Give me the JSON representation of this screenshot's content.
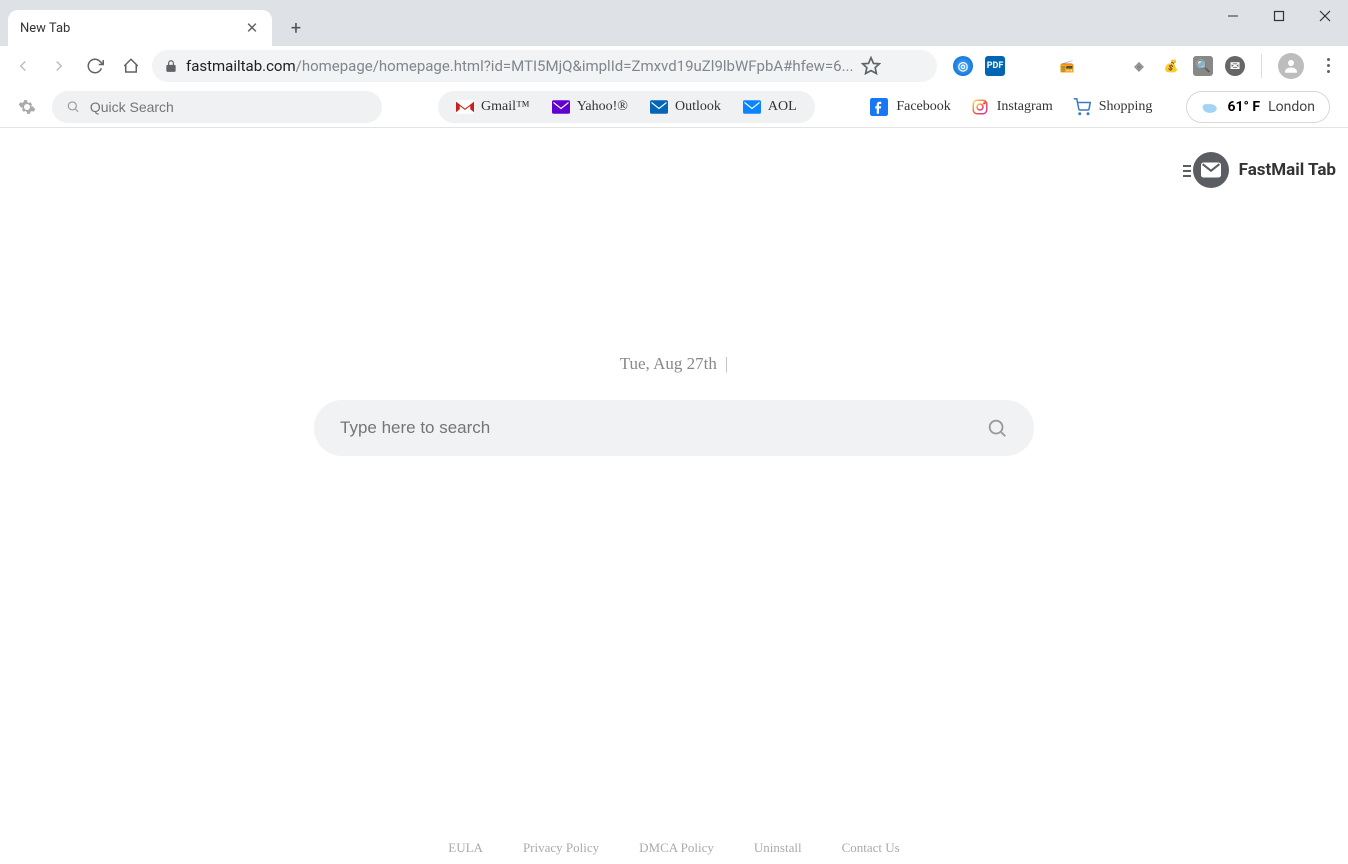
{
  "browser": {
    "tab_title": "New Tab",
    "url_host": "fastmailtab.com",
    "url_path": "/homepage/homepage.html?id=MTI5MjQ&implId=Zmxvd19uZl9lbWFpbA#hfew=6..."
  },
  "toolbar": {
    "quick_search_placeholder": "Quick Search",
    "mail_links": [
      {
        "label": "Gmail™",
        "color": "#d93025"
      },
      {
        "label": "Yahoo!®",
        "color": "#6b1fb3"
      },
      {
        "label": "Outlook",
        "color": "#0364b8"
      },
      {
        "label": "AOL",
        "color": "#0a84ff"
      }
    ],
    "social_links": [
      {
        "label": "Facebook"
      },
      {
        "label": "Instagram"
      },
      {
        "label": "Shopping"
      }
    ],
    "weather": {
      "temp": "61° F",
      "location": "London"
    }
  },
  "brand": {
    "name": "FastMail Tab"
  },
  "main": {
    "date": "Tue, Aug 27th",
    "search_placeholder": "Type here to search"
  },
  "footer": {
    "links": [
      "EULA",
      "Privacy Policy",
      "DMCA Policy",
      "Uninstall",
      "Contact Us"
    ]
  }
}
